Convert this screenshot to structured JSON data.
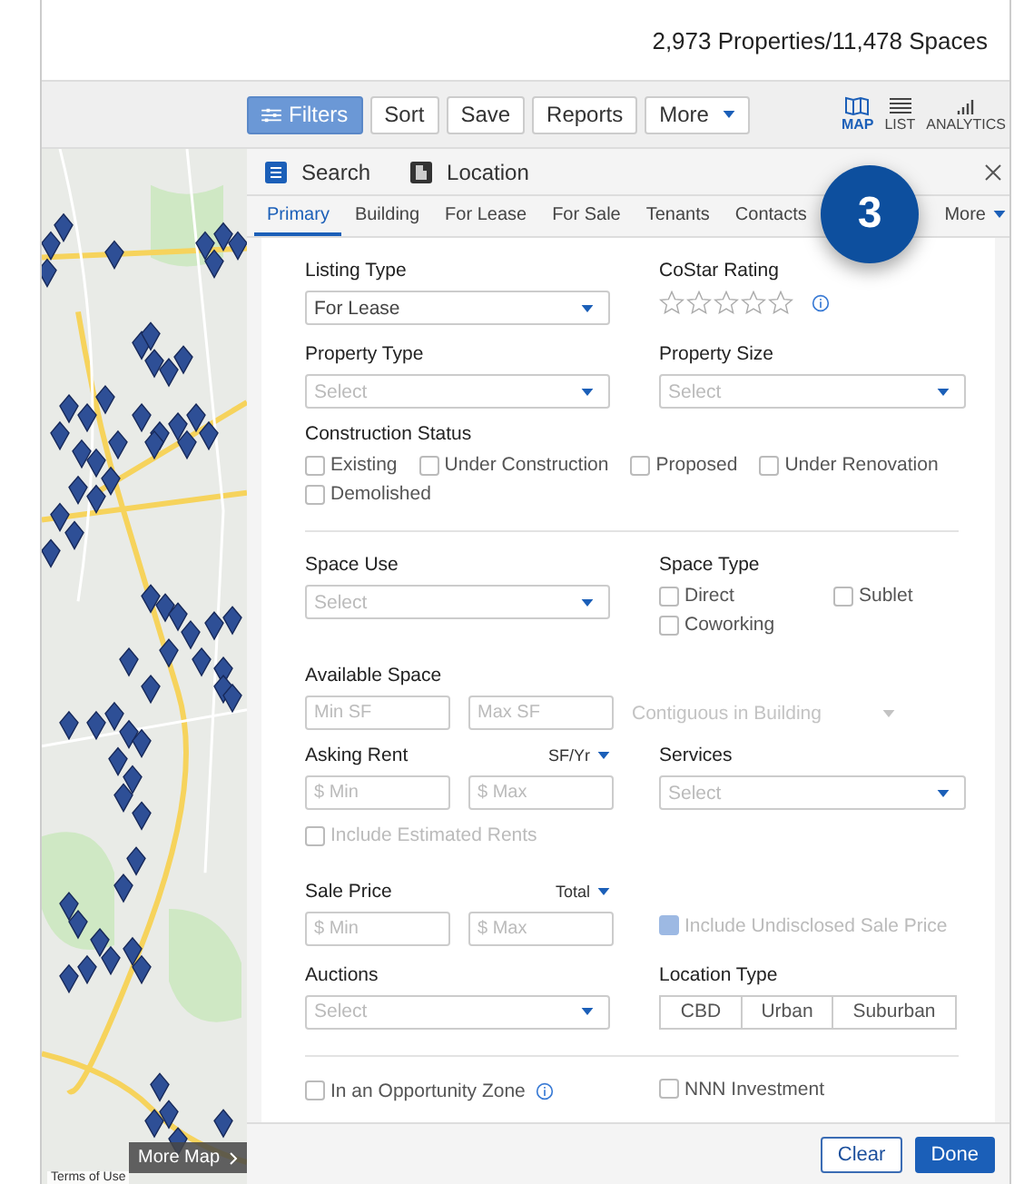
{
  "header": {
    "summary": "2,973 Properties/11,478 Spaces"
  },
  "toolbar": [
    {
      "label": "Filters",
      "kind": "filters",
      "selected": true
    },
    {
      "label": "Sort",
      "kind": "plain",
      "selected": false
    },
    {
      "label": "Save",
      "kind": "plain",
      "selected": false
    },
    {
      "label": "Reports",
      "kind": "plain",
      "selected": false
    },
    {
      "label": "More",
      "kind": "dropdown",
      "selected": false
    }
  ],
  "views": [
    {
      "label": "MAP",
      "kind": "map",
      "selected": true
    },
    {
      "label": "LIST",
      "kind": "list",
      "selected": false
    },
    {
      "label": "ANALYTICS",
      "kind": "analytics",
      "selected": false
    }
  ],
  "map": {
    "more_button": "More Map",
    "terms": "Terms of Use"
  },
  "panel_tabs": [
    {
      "label": "Search",
      "kind": "search"
    },
    {
      "label": "Location",
      "kind": "location"
    }
  ],
  "subtabs": [
    {
      "label": "Primary",
      "kind": "plain",
      "selected": true
    },
    {
      "label": "Building",
      "kind": "plain",
      "selected": false
    },
    {
      "label": "For Lease",
      "kind": "plain",
      "selected": false
    },
    {
      "label": "For Sale",
      "kind": "plain",
      "selected": false
    },
    {
      "label": "Tenants",
      "kind": "plain",
      "selected": false
    },
    {
      "label": "Contacts",
      "kind": "plain",
      "selected": false
    },
    {
      "label": "More",
      "kind": "dropdown",
      "selected": false
    }
  ],
  "badge": "3",
  "form": {
    "listing_type": {
      "label": "Listing Type",
      "value": "For Lease"
    },
    "costar_rating": {
      "label": "CoStar Rating",
      "stars": 0
    },
    "property_type": {
      "label": "Property Type",
      "placeholder": "Select"
    },
    "property_size": {
      "label": "Property Size",
      "placeholder": "Select"
    },
    "construction_status": {
      "label": "Construction Status",
      "options": [
        {
          "label": "Existing",
          "checked": false
        },
        {
          "label": "Under Construction",
          "checked": false
        },
        {
          "label": "Proposed",
          "checked": false
        },
        {
          "label": "Under Renovation",
          "checked": false
        },
        {
          "label": "Demolished",
          "checked": false
        }
      ]
    },
    "space_use": {
      "label": "Space Use",
      "placeholder": "Select"
    },
    "space_type": {
      "label": "Space Type",
      "options": [
        {
          "label": "Direct",
          "checked": false
        },
        {
          "label": "Sublet",
          "checked": false
        },
        {
          "label": "Coworking",
          "checked": false
        }
      ]
    },
    "available_space": {
      "label": "Available Space",
      "min_placeholder": "Min SF",
      "max_placeholder": "Max SF",
      "contiguous": {
        "placeholder": "Contiguous in Building",
        "disabled": true
      }
    },
    "asking_rent": {
      "label": "Asking Rent",
      "unit": "SF/Yr",
      "min_placeholder": "$ Min",
      "max_placeholder": "$ Max",
      "estimated": {
        "label": "Include Estimated Rents",
        "checked": false,
        "disabled": true
      }
    },
    "services": {
      "label": "Services",
      "placeholder": "Select"
    },
    "sale_price": {
      "label": "Sale Price",
      "unit": "Total",
      "min_placeholder": "$ Min",
      "max_placeholder": "$ Max",
      "undisclosed": {
        "label": "Include Undisclosed Sale Price",
        "checked": true,
        "disabled": true
      }
    },
    "auctions": {
      "label": "Auctions",
      "placeholder": "Select"
    },
    "location_type": {
      "label": "Location Type",
      "options": [
        {
          "label": "CBD",
          "selected": false
        },
        {
          "label": "Urban",
          "selected": false
        },
        {
          "label": "Suburban",
          "selected": false
        }
      ]
    },
    "opportunity_zone": {
      "label": "In an Opportunity Zone",
      "checked": false
    },
    "nnn_investment": {
      "label": "NNN Investment",
      "checked": false
    }
  },
  "footer": [
    {
      "label": "Clear",
      "kind": "secondary"
    },
    {
      "label": "Done",
      "kind": "primary"
    }
  ]
}
